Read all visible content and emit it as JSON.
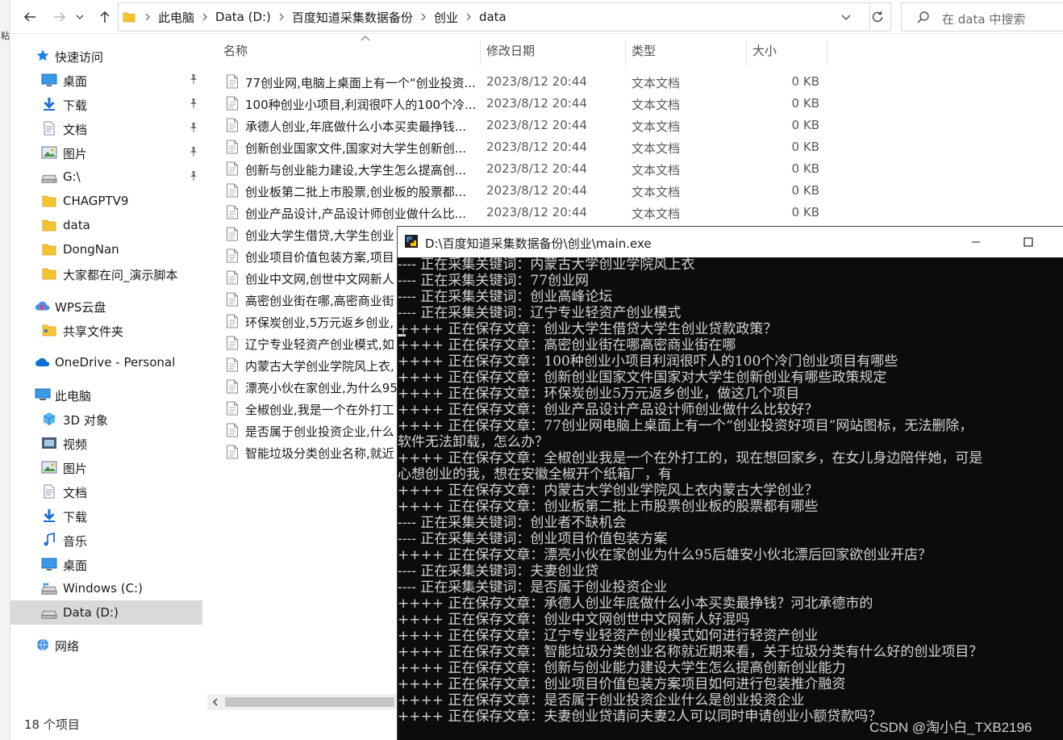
{
  "left_fragment": "粘",
  "address_bar": {
    "crumbs": [
      "此电脑",
      "Data (D:)",
      "百度知道采集数据备份",
      "创业",
      "data"
    ],
    "search_placeholder": "在 data 中搜索"
  },
  "sidebar": {
    "items": [
      {
        "label": "快速访问",
        "icon": "star-icon",
        "indent": 0,
        "pinned": false
      },
      {
        "label": "桌面",
        "icon": "desktop-icon",
        "indent": 1,
        "pinned": true
      },
      {
        "label": "下载",
        "icon": "download-icon",
        "indent": 1,
        "pinned": true
      },
      {
        "label": "文档",
        "icon": "document-icon",
        "indent": 1,
        "pinned": true
      },
      {
        "label": "图片",
        "icon": "pictures-icon",
        "indent": 1,
        "pinned": true
      },
      {
        "label": "G:\\",
        "icon": "drive-icon",
        "indent": 1,
        "pinned": true
      },
      {
        "label": "CHAGPTV9",
        "icon": "folder-icon",
        "indent": 1,
        "pinned": false
      },
      {
        "label": "data",
        "icon": "folder-icon",
        "indent": 1,
        "pinned": false
      },
      {
        "label": "DongNan",
        "icon": "folder-icon",
        "indent": 1,
        "pinned": false
      },
      {
        "label": "大家都在问_演示脚本",
        "icon": "folder-icon",
        "indent": 1,
        "pinned": false
      },
      {
        "label": "WPS云盘",
        "icon": "cloud-icon",
        "indent": 0,
        "pinned": false
      },
      {
        "label": "共享文件夹",
        "icon": "shared-folder-icon",
        "indent": 1,
        "pinned": false
      },
      {
        "label": "OneDrive - Personal",
        "icon": "onedrive-icon",
        "indent": 0,
        "pinned": false
      },
      {
        "label": "此电脑",
        "icon": "computer-icon",
        "indent": 0,
        "pinned": false
      },
      {
        "label": "3D 对象",
        "icon": "3d-objects-icon",
        "indent": 1,
        "pinned": false
      },
      {
        "label": "视频",
        "icon": "video-icon",
        "indent": 1,
        "pinned": false
      },
      {
        "label": "图片",
        "icon": "pictures-icon",
        "indent": 1,
        "pinned": false
      },
      {
        "label": "文档",
        "icon": "document-icon",
        "indent": 1,
        "pinned": false
      },
      {
        "label": "下载",
        "icon": "download-icon",
        "indent": 1,
        "pinned": false
      },
      {
        "label": "音乐",
        "icon": "music-icon",
        "indent": 1,
        "pinned": false
      },
      {
        "label": "桌面",
        "icon": "desktop-icon",
        "indent": 1,
        "pinned": false
      },
      {
        "label": "Windows (C:)",
        "icon": "windows-drive-icon",
        "indent": 1,
        "pinned": false
      },
      {
        "label": "Data (D:)",
        "icon": "drive-icon",
        "indent": 1,
        "pinned": false,
        "selected": true
      },
      {
        "label": "网络",
        "icon": "network-icon",
        "indent": 0,
        "pinned": false
      }
    ]
  },
  "file_list": {
    "columns": {
      "name": "名称",
      "date": "修改日期",
      "type": "类型",
      "size": "大小"
    },
    "rows": [
      {
        "name": "77创业网,电脑上桌面上有一个“创业投资...",
        "date": "2023/8/12 20:44",
        "type": "文本文档",
        "size": "0 KB"
      },
      {
        "name": "100种创业小项目,利润很吓人的100个冷...",
        "date": "2023/8/12 20:44",
        "type": "文本文档",
        "size": "0 KB"
      },
      {
        "name": "承德人创业,年底做什么小本买卖最挣钱...",
        "date": "2023/8/12 20:44",
        "type": "文本文档",
        "size": "0 KB"
      },
      {
        "name": "创新创业国家文件,国家对大学生创新创...",
        "date": "2023/8/12 20:44",
        "type": "文本文档",
        "size": "0 KB"
      },
      {
        "name": "创新与创业能力建设,大学生怎么提高创...",
        "date": "2023/8/12 20:44",
        "type": "文本文档",
        "size": "0 KB"
      },
      {
        "name": "创业板第二批上市股票,创业板的股票都...",
        "date": "2023/8/12 20:44",
        "type": "文本文档",
        "size": "0 KB"
      },
      {
        "name": "创业产品设计,产品设计师创业做什么比...",
        "date": "2023/8/12 20:44",
        "type": "文本文档",
        "size": "0 KB"
      },
      {
        "name": "创业大学生借贷,大学生创业",
        "date": "",
        "type": "",
        "size": ""
      },
      {
        "name": "创业项目价值包装方案,项目",
        "date": "",
        "type": "",
        "size": ""
      },
      {
        "name": "创业中文网,创世中文网新人",
        "date": "",
        "type": "",
        "size": ""
      },
      {
        "name": "高密创业街在哪,高密商业街",
        "date": "",
        "type": "",
        "size": ""
      },
      {
        "name": "环保炭创业,5万元返乡创业,",
        "date": "",
        "type": "",
        "size": ""
      },
      {
        "name": "辽宁专业轻资产创业模式,如",
        "date": "",
        "type": "",
        "size": ""
      },
      {
        "name": "内蒙古大学创业学院风上衣,",
        "date": "",
        "type": "",
        "size": ""
      },
      {
        "name": "漂亮小伙在家创业,为什么95",
        "date": "",
        "type": "",
        "size": ""
      },
      {
        "name": "全椒创业,我是一个在外打工",
        "date": "",
        "type": "",
        "size": ""
      },
      {
        "name": "是否属于创业投资企业,什么",
        "date": "",
        "type": "",
        "size": ""
      },
      {
        "name": "智能垃圾分类创业名称,就近",
        "date": "",
        "type": "",
        "size": ""
      }
    ]
  },
  "status_bar": {
    "item_count": "18 个项目"
  },
  "console": {
    "title": "D:\\百度知道采集数据备份\\创业\\main.exe",
    "lines": [
      "---- 正在采集关键词：内蒙古大学创业学院风上衣",
      "---- 正在采集关键词：77创业网",
      "---- 正在采集关键词：创业高峰论坛",
      "---- 正在采集关键词：辽宁专业轻资产创业模式",
      "++++ 正在保存文章：创业大学生借贷大学生创业贷款政策？",
      "++++ 正在保存文章：高密创业街在哪高密商业街在哪",
      "++++ 正在保存文章：100种创业小项目利润很吓人的100个冷门创业项目有哪些",
      "++++ 正在保存文章：创新创业国家文件国家对大学生创新创业有哪些政策规定",
      "++++ 正在保存文章：环保炭创业5万元返乡创业，做这几个项目",
      "++++ 正在保存文章：创业产品设计产品设计师创业做什么比较好？",
      "++++ 正在保存文章：77创业网电脑上桌面上有一个“创业投资好项目”网站图标，无法删除，",
      "软件无法卸载，怎么办？",
      "++++ 正在保存文章：全椒创业我是一个在外打工的，现在想回家乡，在女儿身边陪伴她，可是",
      "心想创业的我，想在安徽全椒开个纸箱厂，有",
      "++++ 正在保存文章：内蒙古大学创业学院风上衣内蒙古大学创业？",
      "++++ 正在保存文章：创业板第二批上市股票创业板的股票都有哪些",
      "---- 正在采集关键词：创业者不缺机会",
      "---- 正在采集关键词：创业项目价值包装方案",
      "++++ 正在保存文章：漂亮小伙在家创业为什么95后雄安小伙北漂后回家欲创业开店？",
      "---- 正在采集关键词：夫妻创业贷",
      "---- 正在采集关键词：是否属于创业投资企业",
      "++++ 正在保存文章：承德人创业年底做什么小本买卖最挣钱？河北承德市的",
      "++++ 正在保存文章：创业中文网创世中文网新人好混吗",
      "++++ 正在保存文章：辽宁专业轻资产创业模式如何进行轻资产创业",
      "++++ 正在保存文章：智能垃圾分类创业名称就近期来看，关于垃圾分类有什么好的创业项目？",
      "++++ 正在保存文章：创新与创业能力建设大学生怎么提高创新创业能力",
      "++++ 正在保存文章：创业项目价值包装方案项目如何进行包装推介融资",
      "++++ 正在保存文章：是否属于创业投资企业什么是创业投资企业",
      "++++ 正在保存文章：夫妻创业贷请问夫妻2人可以同时申请创业小额贷款吗？"
    ]
  },
  "watermark": "CSDN @淘小白_TXB2196",
  "colors": {
    "folder": "#f4c430",
    "accent": "#0078d4",
    "console_bg": "#0c0c0c",
    "console_text": "#d4d4d4",
    "selected": "#d9d9d9"
  }
}
